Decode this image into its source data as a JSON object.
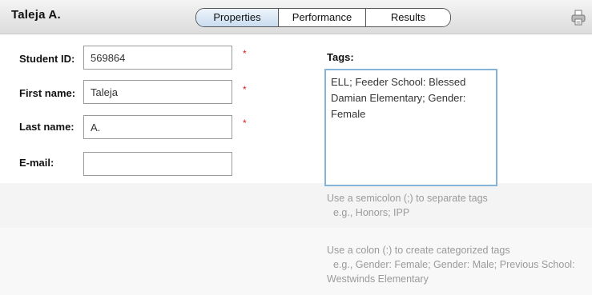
{
  "header": {
    "student_name": "Taleja A.",
    "tabs": [
      {
        "label": "Properties",
        "active": true
      },
      {
        "label": "Performance",
        "active": false
      },
      {
        "label": "Results",
        "active": false
      }
    ],
    "print_icon": "printer-icon"
  },
  "form": {
    "student_id": {
      "label": "Student ID:",
      "value": "569864",
      "required": "*"
    },
    "first_name": {
      "label": "First name:",
      "value": "Taleja",
      "required": "*"
    },
    "last_name": {
      "label": "Last name:",
      "value": "A.",
      "required": "*"
    },
    "email": {
      "label": "E-mail:",
      "value": ""
    }
  },
  "tags": {
    "label": "Tags:",
    "value": "ELL; Feeder School: Blessed Damian Elementary; Gender: Female",
    "hint_semicolon": "Use a semicolon (;) to separate tags",
    "hint_semicolon_example": "e.g., Honors; IPP",
    "hint_colon": "Use a colon (:) to create categorized tags",
    "hint_colon_example_1": "e.g., Gender: Female; Gender: Male; Previous School:",
    "hint_colon_example_2": "Westwinds Elementary"
  },
  "colors": {
    "required": "#d42020",
    "tags_border": "#86b4d9",
    "hint_text": "#9a9a9a"
  }
}
